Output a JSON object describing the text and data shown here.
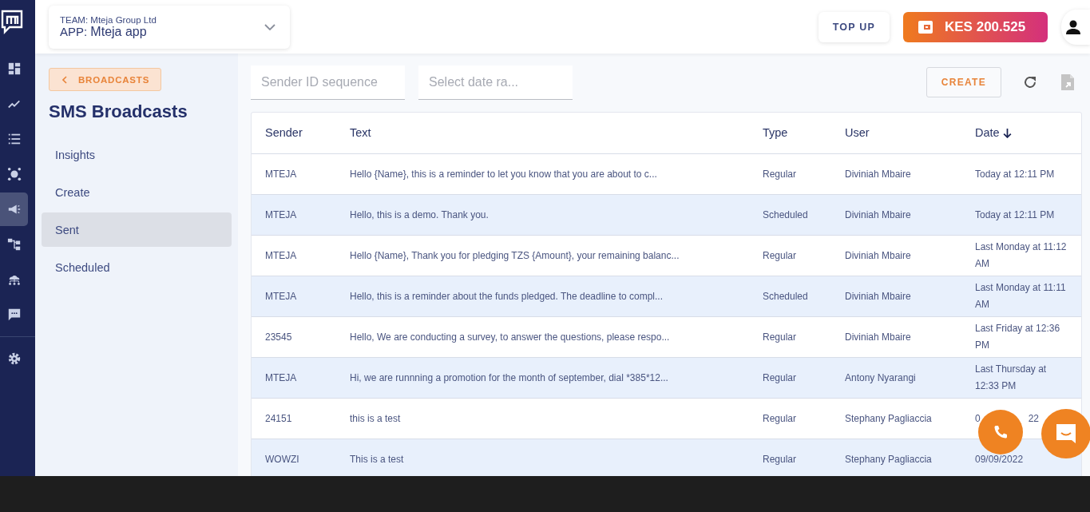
{
  "nav_rail": [
    {
      "kind": "dashboard",
      "selected": false
    },
    {
      "kind": "chart",
      "selected": false
    },
    {
      "kind": "list",
      "selected": false
    },
    {
      "kind": "network",
      "selected": false
    },
    {
      "kind": "megaphone",
      "selected": true
    },
    {
      "kind": "hierarchy",
      "selected": false
    },
    {
      "kind": "cloud",
      "selected": false
    },
    {
      "kind": "chat",
      "selected": false
    },
    {
      "kind": "divider"
    },
    {
      "kind": "settings",
      "selected": false
    }
  ],
  "header": {
    "team_label": "TEAM:",
    "team": "Mteja Group Ltd",
    "app_label": "APP:",
    "app": "Mteja app",
    "top_up": "TOP UP",
    "balance": "KES 200.525"
  },
  "panel": {
    "back": "BROADCASTS",
    "title": "SMS Broadcasts",
    "items": [
      {
        "label": "Insights",
        "selected": false
      },
      {
        "label": "Create",
        "selected": false
      },
      {
        "label": "Sent",
        "selected": true
      },
      {
        "label": "Scheduled",
        "selected": false
      }
    ]
  },
  "filters": [
    {
      "placeholder": "Sender ID sequence"
    },
    {
      "placeholder": "Select date ra..."
    }
  ],
  "create": "CREATE",
  "table": {
    "columns": [
      {
        "label": "Sender",
        "sorted": false
      },
      {
        "label": "Text",
        "sorted": false
      },
      {
        "label": "Type",
        "sorted": false
      },
      {
        "label": "User",
        "sorted": false
      },
      {
        "label": "Date",
        "sorted": true
      }
    ],
    "rows": [
      [
        "MTEJA",
        "Hello {Name}, this is a reminder to let you know that you are about to c...",
        "Regular",
        "Diviniah Mbaire",
        "Today at 12:11 PM"
      ],
      [
        "MTEJA",
        "Hello, this is a demo. Thank you.",
        "Scheduled",
        "Diviniah Mbaire",
        "Today at 12:11 PM"
      ],
      [
        "MTEJA",
        "Hello {Name}, Thank you for pledging TZS {Amount}, your remaining balanc...",
        "Regular",
        "Diviniah Mbaire",
        "Last Monday at 11:12 AM"
      ],
      [
        "MTEJA",
        "Hello, this is a reminder about the funds pledged. The deadline to compl...",
        "Scheduled",
        "Diviniah Mbaire",
        "Last Monday at 11:11 AM"
      ],
      [
        "23545",
        "Hello, We are conducting a survey, to answer the questions, please respo...",
        "Regular",
        "Diviniah Mbaire",
        "Last Friday at 12:36 PM"
      ],
      [
        "MTEJA",
        "Hi, we are runnning a promotion for the month of september, dial *385*12...",
        "Regular",
        "Antony Nyarangi",
        "Last Thursday at 12:33 PM"
      ],
      [
        "24151",
        "this is a test",
        "Regular",
        "Stephany Pagliaccia",
        [
          "0",
          "22"
        ]
      ],
      [
        "WOWZI",
        "This is a test",
        "Regular",
        "Stephany Pagliaccia",
        "09/09/2022"
      ]
    ]
  }
}
